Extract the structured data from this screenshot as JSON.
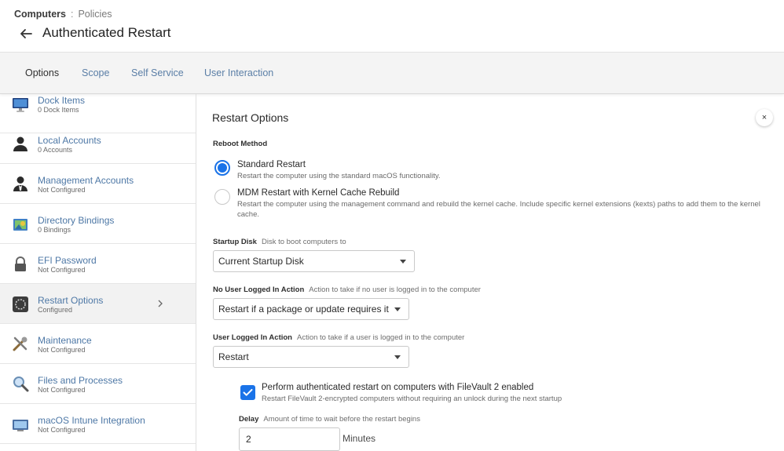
{
  "breadcrumb": {
    "root": "Computers",
    "separator": ":",
    "leaf": "Policies"
  },
  "page_title": "Authenticated Restart",
  "tabs": [
    {
      "label": "Options",
      "active": true
    },
    {
      "label": "Scope",
      "active": false
    },
    {
      "label": "Self Service",
      "active": false
    },
    {
      "label": "User Interaction",
      "active": false
    }
  ],
  "sidebar": {
    "items": [
      {
        "title": "Dock Items",
        "sub": "0 Dock Items",
        "icon": "monitor-icon"
      },
      {
        "title": "Local Accounts",
        "sub": "0 Accounts",
        "icon": "user-icon"
      },
      {
        "title": "Management Accounts",
        "sub": "Not Configured",
        "icon": "admin-user-icon"
      },
      {
        "title": "Directory Bindings",
        "sub": "0 Bindings",
        "icon": "directory-icon"
      },
      {
        "title": "EFI Password",
        "sub": "Not Configured",
        "icon": "lock-icon"
      },
      {
        "title": "Restart Options",
        "sub": "Configured",
        "icon": "restart-icon",
        "active": true
      },
      {
        "title": "Maintenance",
        "sub": "Not Configured",
        "icon": "tools-icon"
      },
      {
        "title": "Files and Processes",
        "sub": "Not Configured",
        "icon": "magnifier-icon"
      },
      {
        "title": "macOS Intune Integration",
        "sub": "Not Configured",
        "icon": "intune-icon"
      }
    ]
  },
  "main": {
    "title": "Restart Options",
    "close_label": "×",
    "reboot_method": {
      "label": "Reboot Method",
      "options": [
        {
          "title": "Standard Restart",
          "desc": "Restart the computer using the standard macOS functionality.",
          "selected": true
        },
        {
          "title": "MDM Restart with Kernel Cache Rebuild",
          "desc": "Restart the computer using the management command and rebuild the kernel cache. Include specific kernel extensions (kexts) paths to add them to the kernel cache.",
          "selected": false
        }
      ]
    },
    "startup_disk": {
      "label": "Startup Disk",
      "desc": "Disk to boot computers to",
      "value": "Current Startup Disk"
    },
    "no_user_action": {
      "label": "No User Logged In Action",
      "desc": "Action to take if no user is logged in to the computer",
      "value": "Restart if a package or update requires it"
    },
    "user_action": {
      "label": "User Logged In Action",
      "desc": "Action to take if a user is logged in to the computer",
      "value": "Restart"
    },
    "filevault": {
      "label": "Perform authenticated restart on computers with FileVault 2 enabled",
      "desc": "Restart FileVault 2-encrypted computers without requiring an unlock during the next startup",
      "checked": true
    },
    "delay": {
      "label": "Delay",
      "desc": "Amount of time to wait before the restart begins",
      "value": "2",
      "unit": "Minutes"
    }
  },
  "colors": {
    "accent": "#1a73e8",
    "link": "#4e78a6"
  }
}
